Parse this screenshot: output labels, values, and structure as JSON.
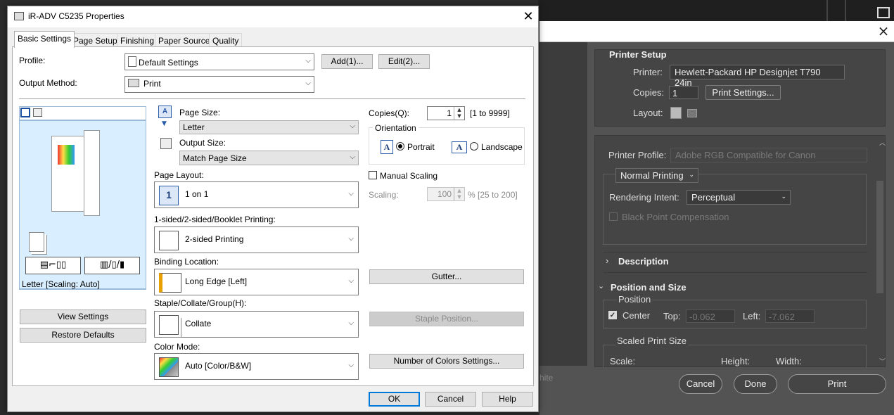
{
  "ps": {
    "printer_setup_title": "Printer Setup",
    "printer_label": "Printer:",
    "printer_value": "Hewlett-Packard HP Designjet T790 24in",
    "copies_label": "Copies:",
    "copies_value": "1",
    "print_settings_button": "Print Settings...",
    "layout_label": "Layout:",
    "printer_profile_label": "Printer Profile:",
    "printer_profile_value": "Adobe RGB Compatible for Canon",
    "normal_printing": "Normal Printing",
    "rendering_intent_label": "Rendering Intent:",
    "rendering_intent_value": "Perceptual",
    "black_point_label": "Black Point Compensation",
    "description_label": "Description",
    "position_size_label": "Position and Size",
    "position_label": "Position",
    "center_label": "Center",
    "top_label": "Top:",
    "top_value": "-0.062",
    "left_label": "Left:",
    "left_value": "-7.062",
    "scaled_print_size_label": "Scaled Print Size",
    "scale_label": "Scale:",
    "height_label": "Height:",
    "width_label": "Width:",
    "white_text": "hite",
    "cancel_button": "Cancel",
    "done_button": "Done",
    "print_button": "Print"
  },
  "win": {
    "title": "iR-ADV C5235 Properties",
    "tabs": [
      "Basic Settings",
      "Page Setup",
      "Finishing",
      "Paper Source",
      "Quality"
    ],
    "profile_label": "Profile:",
    "profile_value": "Default Settings",
    "add_button": "Add(1)...",
    "edit_button": "Edit(2)...",
    "output_method_label": "Output Method:",
    "output_method_value": "Print",
    "page_size_label": "Page Size:",
    "page_size_value": "Letter",
    "output_size_label": "Output Size:",
    "output_size_value": "Match Page Size",
    "copies_label": "Copies(Q):",
    "copies_value": "1",
    "copies_range": "[1 to 9999]",
    "orientation_label": "Orientation",
    "portrait_label": "Portrait",
    "landscape_label": "Landscape",
    "page_layout_label": "Page Layout:",
    "page_layout_value": "1 on 1",
    "manual_scaling_label": "Manual Scaling",
    "scaling_label": "Scaling:",
    "scaling_value": "100",
    "scaling_range": "% [25 to 200]",
    "sided_label": "1-sided/2-sided/Booklet Printing:",
    "sided_value": "2-sided Printing",
    "binding_label": "Binding Location:",
    "binding_value": "Long Edge [Left]",
    "gutter_button": "Gutter...",
    "staple_label": "Staple/Collate/Group(H):",
    "staple_value": "Collate",
    "staple_position_button": "Staple Position...",
    "color_mode_label": "Color Mode:",
    "color_mode_value": "Auto [Color/B&W]",
    "colors_settings_button": "Number of Colors Settings...",
    "preview_caption": "Letter [Scaling: Auto]",
    "view_settings_button": "View Settings",
    "restore_defaults_button": "Restore Defaults",
    "ok_button": "OK",
    "cancel_button": "Cancel",
    "help_button": "Help",
    "layout_icon_text": "1"
  }
}
